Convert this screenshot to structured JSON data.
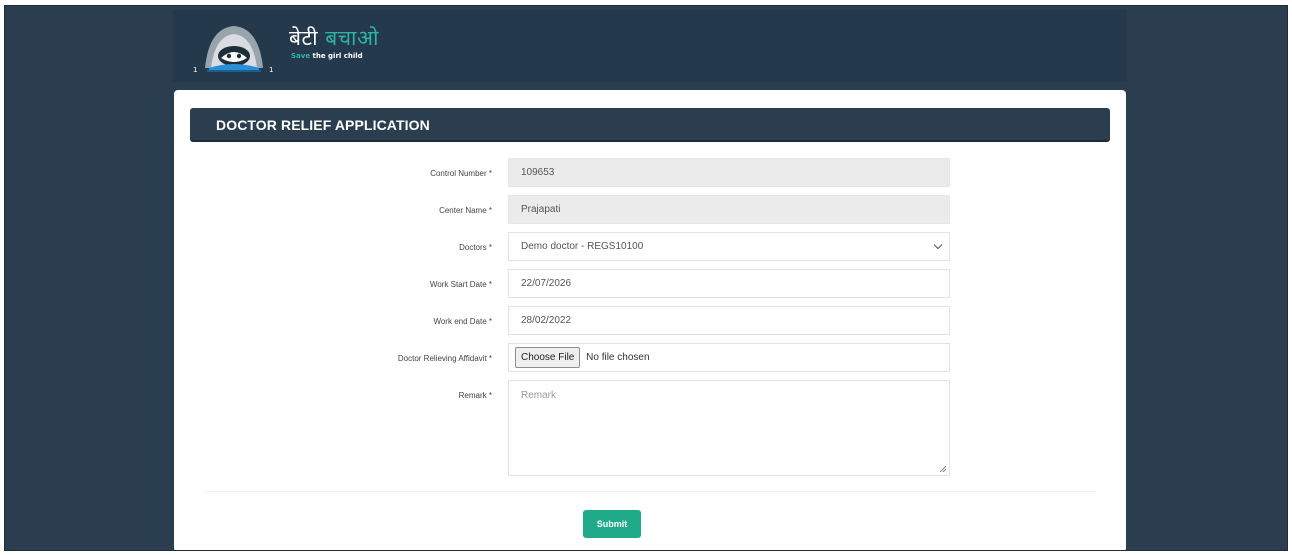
{
  "logo": {
    "hindi_part1": "बेटी ",
    "hindi_part2": "बचाओ",
    "english_part1": "Save ",
    "english_part2": "the girl child",
    "badge_left": "1",
    "badge_right": "1"
  },
  "form": {
    "title": "DOCTOR RELIEF APPLICATION",
    "fields": {
      "control_number": {
        "label": "Control Number *",
        "value": "109653"
      },
      "center_name": {
        "label": "Center Name *",
        "value": "Prajapati"
      },
      "doctors": {
        "label": "Doctors *",
        "value": "Demo doctor - REGS10100"
      },
      "work_start_date": {
        "label": "Work Start Date *",
        "value": "22/07/2026"
      },
      "work_end_date": {
        "label": "Work end Date *",
        "value": "28/02/2022"
      },
      "affidavit": {
        "label": "Doctor Relieving Affidavit *",
        "button": "Choose File",
        "status": "No file chosen"
      },
      "remark": {
        "label": "Remark *",
        "placeholder": "Remark"
      }
    },
    "submit_label": "Submit"
  },
  "colors": {
    "background": "#2b3e50",
    "header": "#25394d",
    "accent": "#1fab89",
    "logo_teal": "#2bb5a3"
  }
}
